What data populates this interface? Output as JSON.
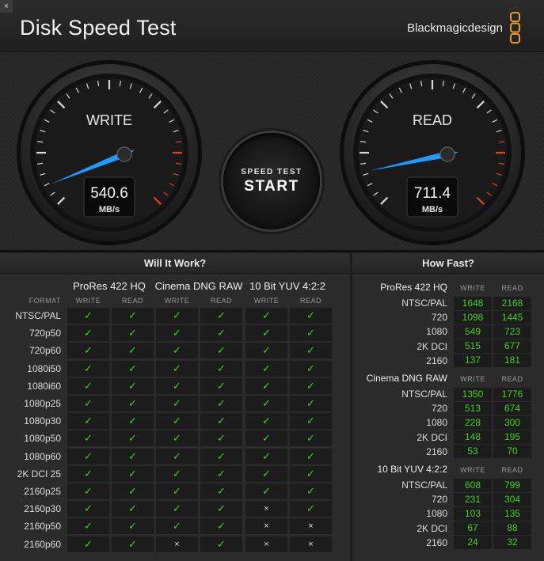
{
  "window": {
    "close_glyph": "×",
    "title": "Disk Speed Test",
    "brand": "Blackmagicdesign"
  },
  "gauges": {
    "write": {
      "label": "WRITE",
      "value": "540.6",
      "unit": "MB/s",
      "needle_angle_deg": -22
    },
    "read": {
      "label": "READ",
      "value": "711.4",
      "unit": "MB/s",
      "needle_angle_deg": -12
    }
  },
  "controls": {
    "settings_icon": "gear-icon",
    "start_small": "SPEED TEST",
    "start_big": "START"
  },
  "will_it_work": {
    "title": "Will It Work?",
    "format_label": "FORMAT",
    "codecs": [
      "ProRes 422 HQ",
      "Cinema DNG RAW",
      "10 Bit YUV 4:2:2"
    ],
    "sub_labels": [
      "WRITE",
      "READ"
    ],
    "rows": [
      {
        "format": "NTSC/PAL",
        "cells": [
          "y",
          "y",
          "y",
          "y",
          "y",
          "y"
        ]
      },
      {
        "format": "720p50",
        "cells": [
          "y",
          "y",
          "y",
          "y",
          "y",
          "y"
        ]
      },
      {
        "format": "720p60",
        "cells": [
          "y",
          "y",
          "y",
          "y",
          "y",
          "y"
        ]
      },
      {
        "format": "1080i50",
        "cells": [
          "y",
          "y",
          "y",
          "y",
          "y",
          "y"
        ]
      },
      {
        "format": "1080i60",
        "cells": [
          "y",
          "y",
          "y",
          "y",
          "y",
          "y"
        ]
      },
      {
        "format": "1080p25",
        "cells": [
          "y",
          "y",
          "y",
          "y",
          "y",
          "y"
        ]
      },
      {
        "format": "1080p30",
        "cells": [
          "y",
          "y",
          "y",
          "y",
          "y",
          "y"
        ]
      },
      {
        "format": "1080p50",
        "cells": [
          "y",
          "y",
          "y",
          "y",
          "y",
          "y"
        ]
      },
      {
        "format": "1080p60",
        "cells": [
          "y",
          "y",
          "y",
          "y",
          "y",
          "y"
        ]
      },
      {
        "format": "2K DCI 25",
        "cells": [
          "y",
          "y",
          "y",
          "y",
          "y",
          "y"
        ]
      },
      {
        "format": "2160p25",
        "cells": [
          "y",
          "y",
          "y",
          "y",
          "y",
          "y"
        ]
      },
      {
        "format": "2160p30",
        "cells": [
          "y",
          "y",
          "y",
          "y",
          "n",
          "y"
        ]
      },
      {
        "format": "2160p50",
        "cells": [
          "y",
          "y",
          "y",
          "y",
          "n",
          "n"
        ]
      },
      {
        "format": "2160p60",
        "cells": [
          "y",
          "y",
          "n",
          "y",
          "n",
          "n"
        ]
      }
    ]
  },
  "how_fast": {
    "title": "How Fast?",
    "sub_labels": [
      "WRITE",
      "READ"
    ],
    "groups": [
      {
        "name": "ProRes 422 HQ",
        "rows": [
          {
            "label": "NTSC/PAL",
            "write": "1648",
            "read": "2168"
          },
          {
            "label": "720",
            "write": "1098",
            "read": "1445"
          },
          {
            "label": "1080",
            "write": "549",
            "read": "723"
          },
          {
            "label": "2K DCI",
            "write": "515",
            "read": "677"
          },
          {
            "label": "2160",
            "write": "137",
            "read": "181"
          }
        ]
      },
      {
        "name": "Cinema DNG RAW",
        "rows": [
          {
            "label": "NTSC/PAL",
            "write": "1350",
            "read": "1776"
          },
          {
            "label": "720",
            "write": "513",
            "read": "674"
          },
          {
            "label": "1080",
            "write": "228",
            "read": "300"
          },
          {
            "label": "2K DCI",
            "write": "148",
            "read": "195"
          },
          {
            "label": "2160",
            "write": "53",
            "read": "70"
          }
        ]
      },
      {
        "name": "10 Bit YUV 4:2:2",
        "rows": [
          {
            "label": "NTSC/PAL",
            "write": "608",
            "read": "799"
          },
          {
            "label": "720",
            "write": "231",
            "read": "304"
          },
          {
            "label": "1080",
            "write": "103",
            "read": "135"
          },
          {
            "label": "2K DCI",
            "write": "67",
            "read": "88"
          },
          {
            "label": "2160",
            "write": "24",
            "read": "32"
          }
        ]
      }
    ]
  },
  "glyphs": {
    "tick": "✓",
    "cross": "×"
  },
  "colors": {
    "accent_blue": "#1e9bff",
    "green": "#41d11b",
    "red_zone": "#e0412b"
  }
}
